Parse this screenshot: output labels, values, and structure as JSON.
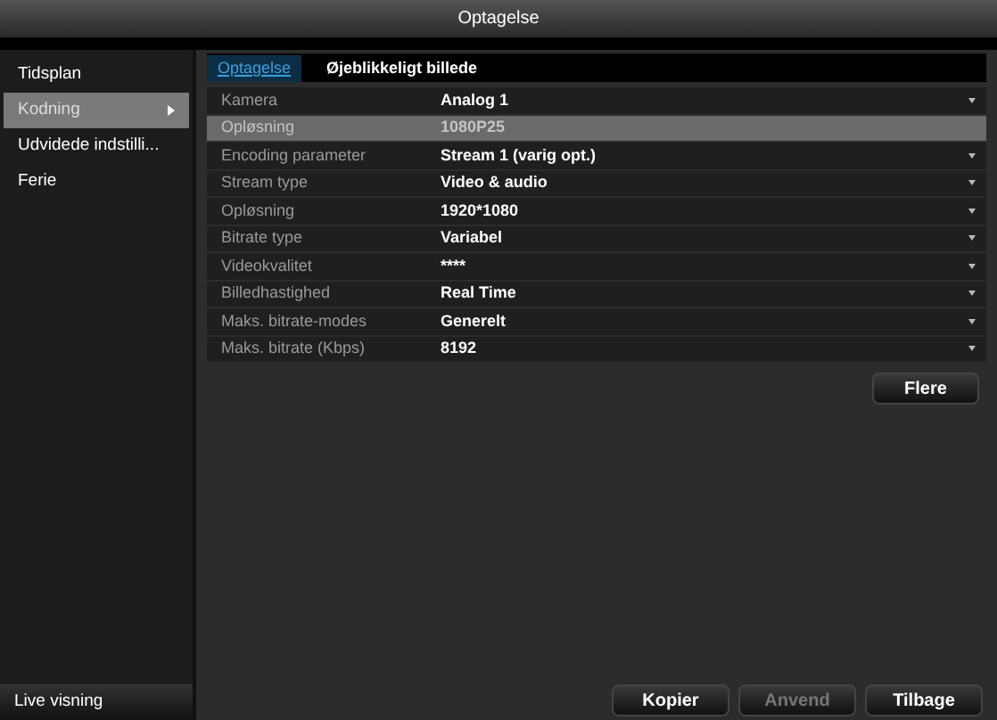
{
  "window": {
    "title": "Optagelse"
  },
  "sidebar": {
    "items": [
      {
        "label": "Tidsplan",
        "selected": false
      },
      {
        "label": "Kodning",
        "selected": true
      },
      {
        "label": "Udvidede indstilli...",
        "selected": false
      },
      {
        "label": "Ferie",
        "selected": false
      }
    ],
    "footer": "Live visning"
  },
  "tabs": [
    {
      "label": "Optagelse",
      "selected": true
    },
    {
      "label": "Øjeblikkeligt billede",
      "selected": false
    }
  ],
  "settings": [
    {
      "label": "Kamera",
      "value": "Analog 1",
      "disabled": false
    },
    {
      "label": "Opløsning",
      "value": "1080P25",
      "disabled": true
    },
    {
      "label": "Encoding parameter",
      "value": "Stream 1 (varig opt.)",
      "disabled": false
    },
    {
      "label": "Stream type",
      "value": "Video & audio",
      "disabled": false
    },
    {
      "label": "Opløsning",
      "value": "1920*1080",
      "disabled": false
    },
    {
      "label": "Bitrate type",
      "value": "Variabel",
      "disabled": false
    },
    {
      "label": "Videokvalitet",
      "value": "****",
      "disabled": false
    },
    {
      "label": "Billedhastighed",
      "value": "Real Time",
      "disabled": false
    },
    {
      "label": "Maks. bitrate-modes",
      "value": "Generelt",
      "disabled": false
    },
    {
      "label": "Maks. bitrate (Kbps)",
      "value": "8192",
      "disabled": false
    }
  ],
  "more_button": {
    "label": "Flere"
  },
  "buttons": [
    {
      "label": "Kopier",
      "disabled": false
    },
    {
      "label": "Anvend",
      "disabled": true
    },
    {
      "label": "Tilbage",
      "disabled": false
    }
  ]
}
